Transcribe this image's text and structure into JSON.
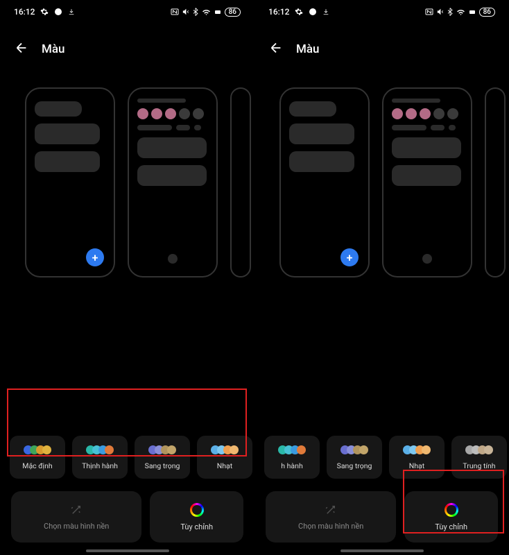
{
  "status": {
    "time": "16:12",
    "battery": "86"
  },
  "header": {
    "title": "Màu"
  },
  "palettes_left": [
    {
      "label": "Mặc định",
      "colors": [
        "#3a67e0",
        "#3fa65a",
        "#d89a2e",
        "#e0b23e"
      ]
    },
    {
      "label": "Thịnh hành",
      "colors": [
        "#2ab8a8",
        "#47c1d4",
        "#3a9be0",
        "#e07a3a"
      ]
    },
    {
      "label": "Sang trọng",
      "colors": [
        "#6a6fd0",
        "#8a8fd8",
        "#b0945e",
        "#c2a56a"
      ]
    },
    {
      "label": "Nhạt",
      "colors": [
        "#5bb0e8",
        "#7ec8f0",
        "#f0a050",
        "#f0b870"
      ]
    }
  ],
  "palettes_right": [
    {
      "label": "h hành",
      "colors": [
        "#2ab8a8",
        "#47c1d4",
        "#3a9be0",
        "#e07a3a"
      ]
    },
    {
      "label": "Sang trọng",
      "colors": [
        "#6a6fd0",
        "#8a8fd8",
        "#b0945e",
        "#c2a56a"
      ]
    },
    {
      "label": "Nhạt",
      "colors": [
        "#5bb0e8",
        "#7ec8f0",
        "#f0a050",
        "#f0b870"
      ]
    },
    {
      "label": "Trung tính",
      "colors": [
        "#a8a8a8",
        "#bcbcbc",
        "#c0a888",
        "#c8b498"
      ]
    }
  ],
  "bottom": {
    "wallpaper": "Chọn màu hình nền",
    "custom": "Tùy chỉnh"
  },
  "preview_accent": {
    "dots": [
      "#b36b86",
      "#b36b86",
      "#b36b86",
      "#444",
      "#444"
    ]
  }
}
